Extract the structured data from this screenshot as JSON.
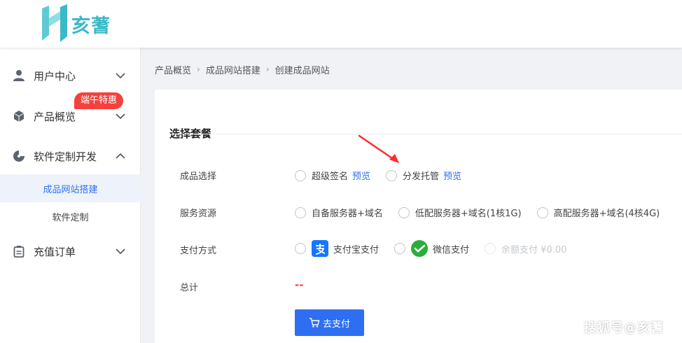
{
  "header": {
    "logo_text": "亥蓍"
  },
  "sidebar": {
    "items": [
      {
        "label": "用户中心",
        "icon": "user-icon"
      },
      {
        "label": "产品概览",
        "icon": "cube-icon",
        "badge": "端午特惠"
      },
      {
        "label": "软件定制开发",
        "icon": "pie-chart-icon",
        "expanded": true,
        "children": [
          {
            "label": "成品网站搭建",
            "active": true
          },
          {
            "label": "软件定制"
          }
        ]
      },
      {
        "label": "充值订单",
        "icon": "clipboard-icon"
      }
    ]
  },
  "breadcrumb": [
    "产品概览",
    "成品网站搭建",
    "创建成品网站"
  ],
  "form": {
    "section_title": "选择套餐",
    "product": {
      "label": "成品选择",
      "options": [
        {
          "label": "超级签名",
          "link": "预览"
        },
        {
          "label": "分发托管",
          "link": "预览"
        }
      ]
    },
    "service": {
      "label": "服务资源",
      "options": [
        "自备服务器+域名",
        "低配服务器+域名(1核1G)",
        "高配服务器+域名(4核4G)"
      ]
    },
    "payment": {
      "label": "支付方式",
      "options": [
        {
          "label": "支付宝支付",
          "icon": "alipay-icon"
        },
        {
          "label": "微信支付",
          "icon": "wechat-icon"
        },
        {
          "label": "余额支付 ¥0.00",
          "disabled": true
        }
      ]
    },
    "total": {
      "label": "总计",
      "value": "--"
    },
    "submit_label": "去支付"
  },
  "watermark": "搜狐号@亥蓍",
  "colors": {
    "primary": "#2e6ff2",
    "badge": "#f5413d",
    "logo": "#3ab9c9",
    "alipay": "#1677ff",
    "wechat": "#2aae3a"
  }
}
